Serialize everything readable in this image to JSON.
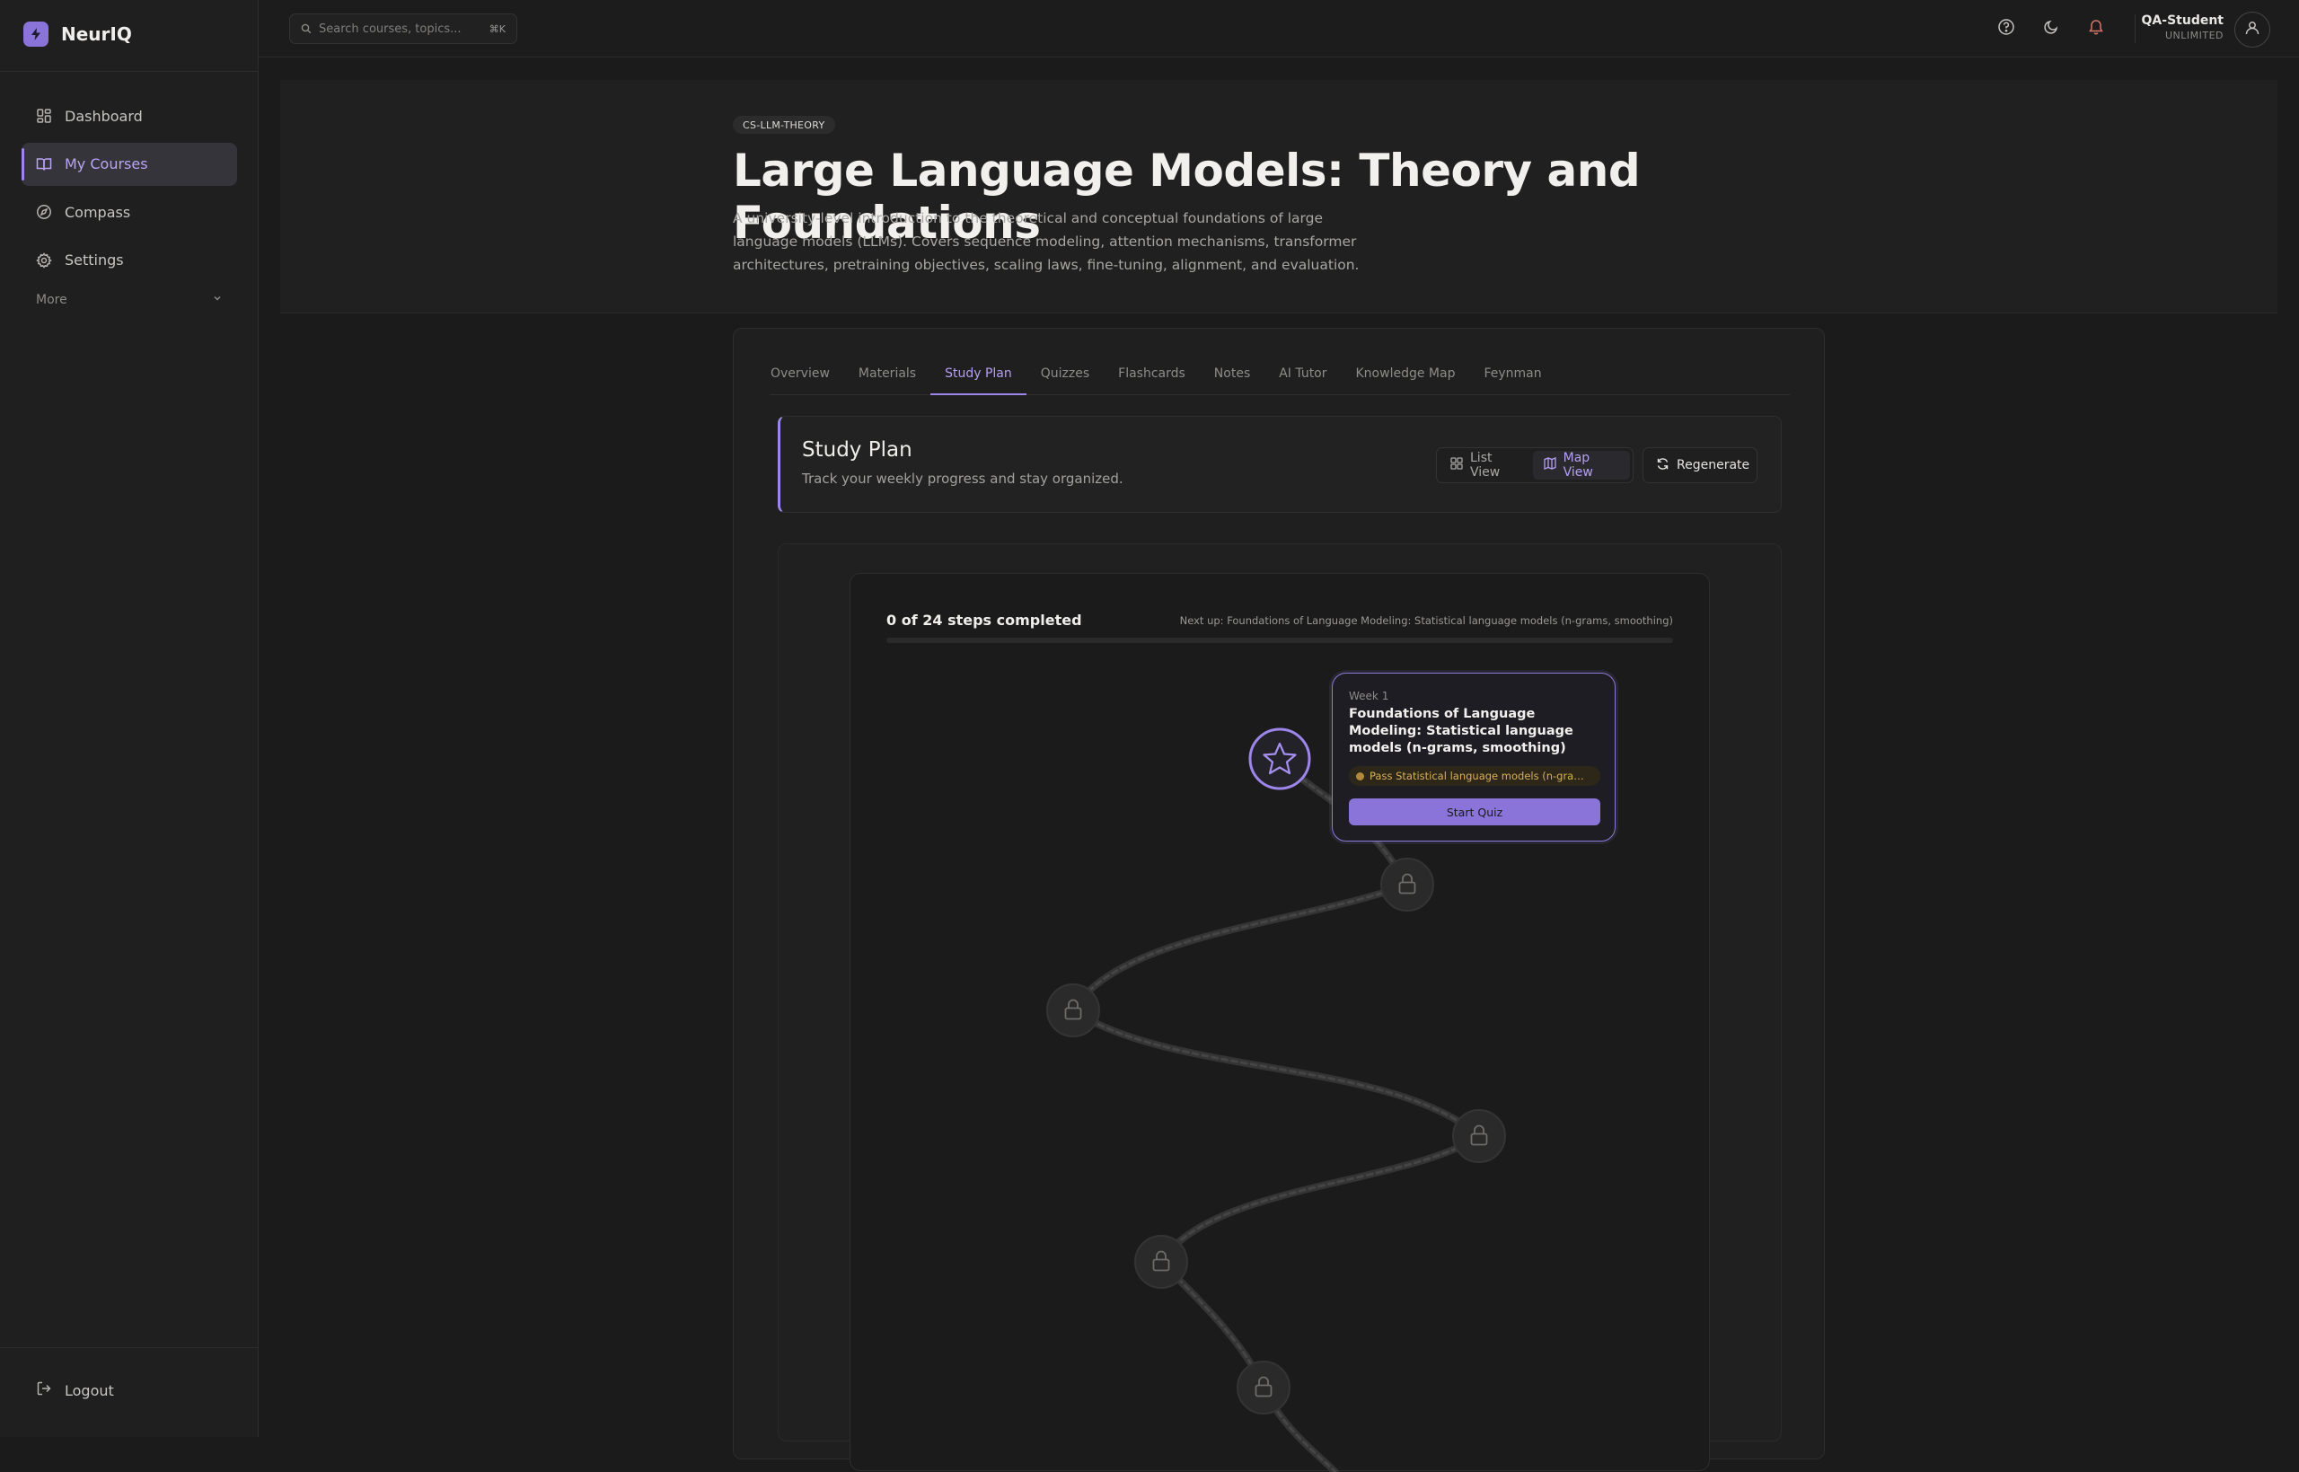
{
  "app": {
    "name": "NeurIQ"
  },
  "sidebar": {
    "items": [
      {
        "label": "Dashboard",
        "icon": "dashboard-icon"
      },
      {
        "label": "My Courses",
        "icon": "book-icon",
        "active": true
      },
      {
        "label": "Compass",
        "icon": "compass-icon"
      },
      {
        "label": "Settings",
        "icon": "gear-icon"
      }
    ],
    "more_label": "More",
    "logout_label": "Logout"
  },
  "topbar": {
    "search_placeholder": "Search courses, topics...",
    "search_shortcut": "⌘K",
    "user_name": "QA-Student",
    "user_plan": "UNLIMITED"
  },
  "course": {
    "code": "CS-LLM-THEORY",
    "title": "Large Language Models: Theory and Foundations",
    "description": "A university-level introduction to the theoretical and conceptual foundations of large language models (LLMs). Covers sequence modeling, attention mechanisms, transformer architectures, pretraining objectives, scaling laws, fine-tuning, alignment, and evaluation."
  },
  "tabs": [
    {
      "label": "Overview"
    },
    {
      "label": "Materials"
    },
    {
      "label": "Study Plan",
      "active": true
    },
    {
      "label": "Quizzes"
    },
    {
      "label": "Flashcards"
    },
    {
      "label": "Notes"
    },
    {
      "label": "AI Tutor"
    },
    {
      "label": "Knowledge Map"
    },
    {
      "label": "Feynman"
    }
  ],
  "study_plan": {
    "title": "Study Plan",
    "subtitle": "Track your weekly progress and stay organized.",
    "list_view_label": "List View",
    "map_view_label": "Map View",
    "active_view": "Map View",
    "regenerate_label": "Regenerate"
  },
  "map": {
    "progress_text": "0 of 24 steps completed",
    "steps_completed": 0,
    "steps_total": 24,
    "next_up": "Next up: Foundations of Language Modeling: Statistical language models (n-grams, smoothing)",
    "nodes": [
      {
        "state": "current",
        "icon": "star-icon"
      },
      {
        "state": "locked",
        "icon": "lock-icon"
      },
      {
        "state": "locked",
        "icon": "lock-icon"
      },
      {
        "state": "locked",
        "icon": "lock-icon"
      },
      {
        "state": "locked",
        "icon": "lock-icon"
      },
      {
        "state": "locked",
        "icon": "lock-icon"
      }
    ],
    "popover": {
      "week": "Week 1",
      "title": "Foundations of Language Modeling: Statistical language models (n-grams, smoothing)",
      "requirement": "Pass Statistical language models (n-grams, smoothing)",
      "button_label": "Start Quiz"
    }
  },
  "colors": {
    "accent": "#9d86ea",
    "background": "#1b1b1b",
    "warning_text": "#d9b05a"
  }
}
